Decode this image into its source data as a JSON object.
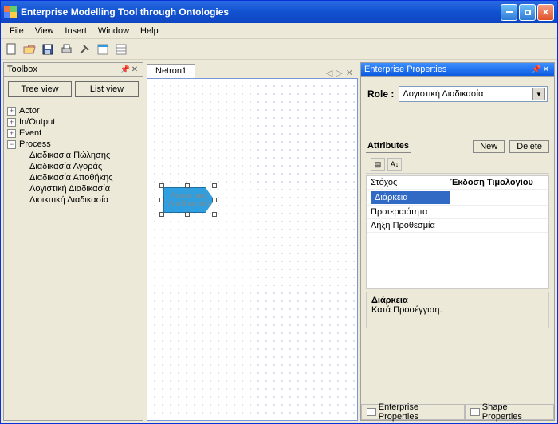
{
  "title": "Enterprise Modelling Tool through Ontologies",
  "menu": [
    "File",
    "View",
    "Insert",
    "Window",
    "Help"
  ],
  "toolbar_icons": [
    "new-icon",
    "open-icon",
    "save-icon",
    "print-icon",
    "tools-icon",
    "form-icon",
    "props-icon"
  ],
  "toolbox": {
    "title": "Toolbox",
    "tree_view": "Tree view",
    "list_view": "List view",
    "tree": {
      "actor": "Actor",
      "inout": "In/Output",
      "event": "Event",
      "process": "Process",
      "children": [
        "Διαδικασία Πώλησης",
        "Διαδικασία Αγοράς",
        "Διαδικασία Αποθήκης",
        "Λογιστική Διαδικασία",
        "Διοικιτική Διαδικασία"
      ]
    }
  },
  "doc": {
    "tab": "Netron1",
    "shape_text": "Λογιστική Διαδικασία"
  },
  "props": {
    "title": "Enterprise Properties",
    "role_label": "Role :",
    "role_value": "Λογιστική Διαδικασία",
    "attr_label": "Attributes",
    "new": "New",
    "del": "Delete",
    "rows": [
      {
        "name": "Στόχος",
        "value": "Έκδοση Τιμολογίου"
      },
      {
        "name": "Διάρκεια",
        "value": ""
      },
      {
        "name": "Προτεραιότητα",
        "value": ""
      },
      {
        "name": "Λήξη Προθεσμία",
        "value": ""
      }
    ],
    "desc_name": "Διάρκεια",
    "desc_text": "Κατά Προσέγγιση.",
    "tab_ent": "Enterprise Properties",
    "tab_shape": "Shape Properties"
  }
}
